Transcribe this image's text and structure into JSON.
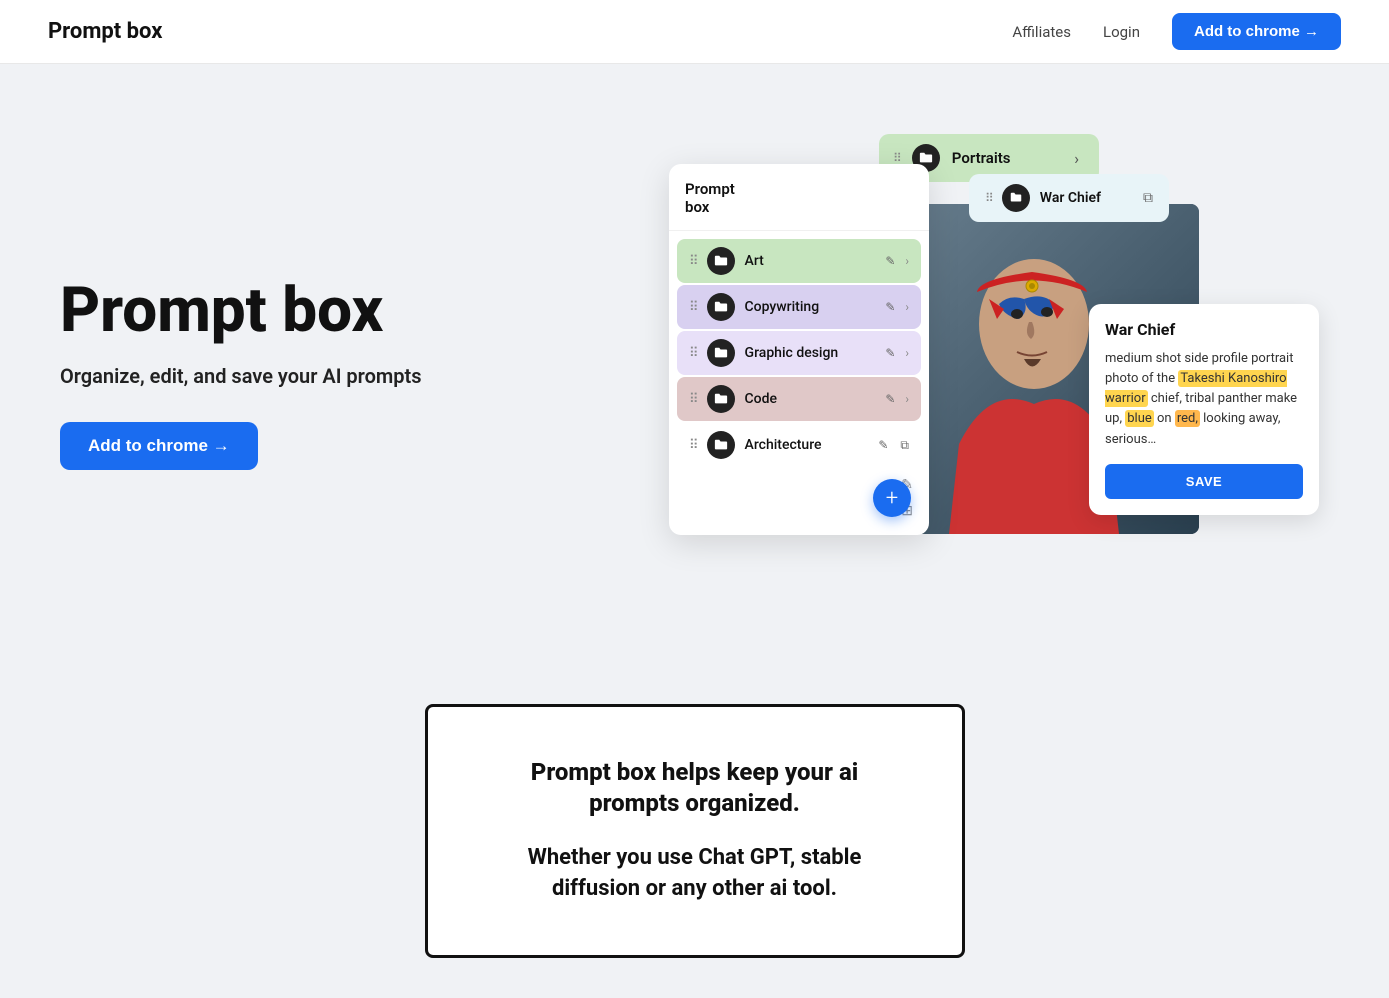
{
  "navbar": {
    "logo": "Prompt box",
    "affiliates_label": "Affiliates",
    "login_label": "Login",
    "cta_label": "Add to chrome →"
  },
  "hero": {
    "title": "Prompt box",
    "subtitle": "Organize, edit, and save your AI prompts",
    "cta_label": "Add to chrome →"
  },
  "prompt_panel": {
    "title_line1": "Prompt",
    "title_line2": "box",
    "items": [
      {
        "label": "Art",
        "bg": "art"
      },
      {
        "label": "Copywriting",
        "bg": "copy"
      },
      {
        "label": "Graphic design",
        "bg": "graphic"
      },
      {
        "label": "Code",
        "bg": "code"
      },
      {
        "label": "Architecture",
        "bg": "arch"
      }
    ],
    "fab_label": "+"
  },
  "portraits": {
    "label": "Portraits",
    "chevron": "›"
  },
  "war_chief_row": {
    "label": "War Chief"
  },
  "wc_card": {
    "title": "War Chief",
    "text_before": "medium shot side profile portrait photo of the ",
    "highlight1": "Takeshi Kanoshiro warrior",
    "text_mid1": " chief, tribal panther make up, ",
    "highlight2": "blue",
    "text_mid2": " on ",
    "highlight3": "red,",
    "text_end": " looking away, serious…",
    "save_label": "SAVE"
  },
  "bottom": {
    "title": "Prompt box helps keep your ai prompts organized.",
    "subtitle": "Whether you use Chat GPT, stable diffusion or any other ai tool."
  }
}
